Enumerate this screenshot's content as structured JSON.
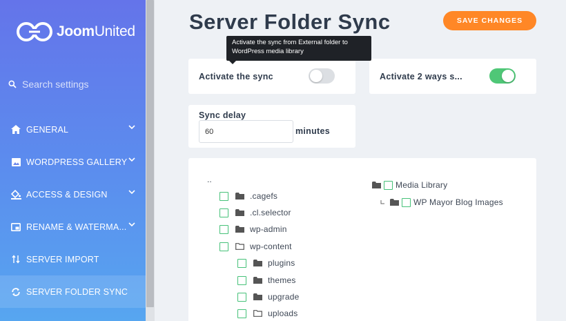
{
  "sidebar": {
    "logo_text_bold": "Joom",
    "logo_text_rest": "United",
    "search_placeholder": "Search settings",
    "items": [
      {
        "label": "GENERAL",
        "icon": "home-icon",
        "has_chevron": true
      },
      {
        "label": "WORDPRESS GALLERY",
        "icon": "image-icon",
        "has_chevron": true
      },
      {
        "label": "ACCESS & DESIGN",
        "icon": "paint-bucket-icon",
        "has_chevron": true
      },
      {
        "label": "RENAME & WATERMA...",
        "icon": "picture-in-picture-icon",
        "has_chevron": true
      },
      {
        "label": "SERVER IMPORT",
        "icon": "import-arrows-icon",
        "has_chevron": false
      },
      {
        "label": "SERVER FOLDER SYNC",
        "icon": "sync-icon",
        "has_chevron": false,
        "active": true
      }
    ]
  },
  "header": {
    "title": "Server Folder Sync",
    "save_label": "SAVE CHANGES"
  },
  "tooltip": {
    "text": "Activate the sync from External folder to WordPress media library"
  },
  "settings": {
    "activate_sync_label": "Activate the sync",
    "activate_sync_on": false,
    "two_ways_label": "Activate 2 ways s...",
    "two_ways_on": true,
    "sync_delay_label": "Sync delay",
    "sync_delay_value": "60",
    "sync_delay_unit": "minutes"
  },
  "server_tree": {
    "parent": "..",
    "folders": [
      {
        "name": ".cagefs",
        "level": 1,
        "open": false
      },
      {
        "name": ".cl.selector",
        "level": 1,
        "open": false
      },
      {
        "name": "wp-admin",
        "level": 1,
        "open": false
      },
      {
        "name": "wp-content",
        "level": 1,
        "open": true
      },
      {
        "name": "plugins",
        "level": 2,
        "open": false
      },
      {
        "name": "themes",
        "level": 2,
        "open": false
      },
      {
        "name": "upgrade",
        "level": 2,
        "open": false
      },
      {
        "name": "uploads",
        "level": 2,
        "open": true
      }
    ]
  },
  "media_tree": {
    "root": "Media Library",
    "child": "WP Mayor Blog Images"
  },
  "colors": {
    "accent_orange": "#ff8726",
    "toggle_on": "#4fc777",
    "checkbox_green": "#45c178",
    "title_dark": "#2f3b4c"
  }
}
